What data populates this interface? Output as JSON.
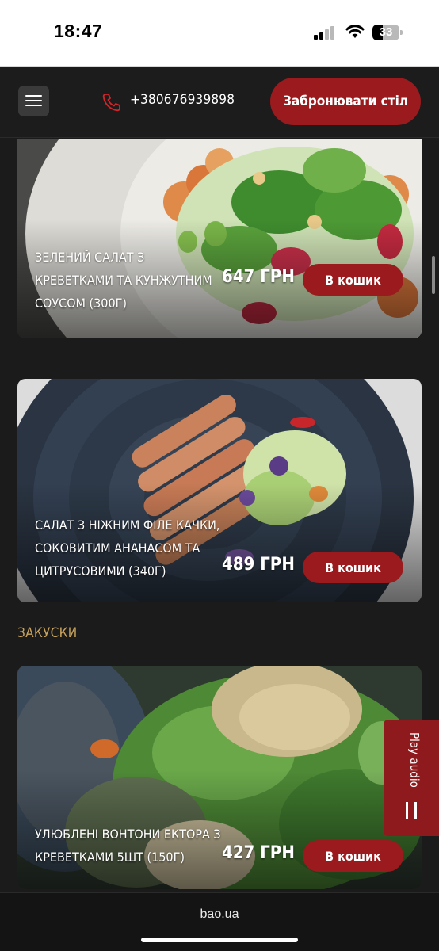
{
  "status_bar": {
    "time": "18:47",
    "battery": "33"
  },
  "header": {
    "phone": "+380676939898",
    "book_label": "Забронювати стіл"
  },
  "menu": {
    "items": [
      {
        "title": "ЗЕЛЕНИЙ САЛАТ З КРЕВЕТКАМИ ТА КУНЖУТНИМ СОУСОМ (300г)",
        "price": "647 ГРН",
        "button": "В кошик"
      },
      {
        "title": "САЛАТ З НІЖНИМ ФІЛЕ КАЧКИ, СОКОВИТИМ АНАНАСОМ ТА ЦИТРУСОВИМИ (340г)",
        "price": "489 ГРН",
        "button": "В кошик"
      },
      {
        "title": "УЛЮБЛЕНІ ВОНТОНИ ЕКТОРА З КРЕВЕТКАМИ 5шт (150г)",
        "price": "427 ГРН",
        "button": "В кошик"
      }
    ],
    "section_title": "ЗАКУСКИ"
  },
  "audio": {
    "label": "Play audio"
  },
  "browser": {
    "url": "bao.ua"
  },
  "colors": {
    "accent": "#9a1a1d",
    "section": "#c9a35b",
    "background": "#1b1b1b"
  }
}
